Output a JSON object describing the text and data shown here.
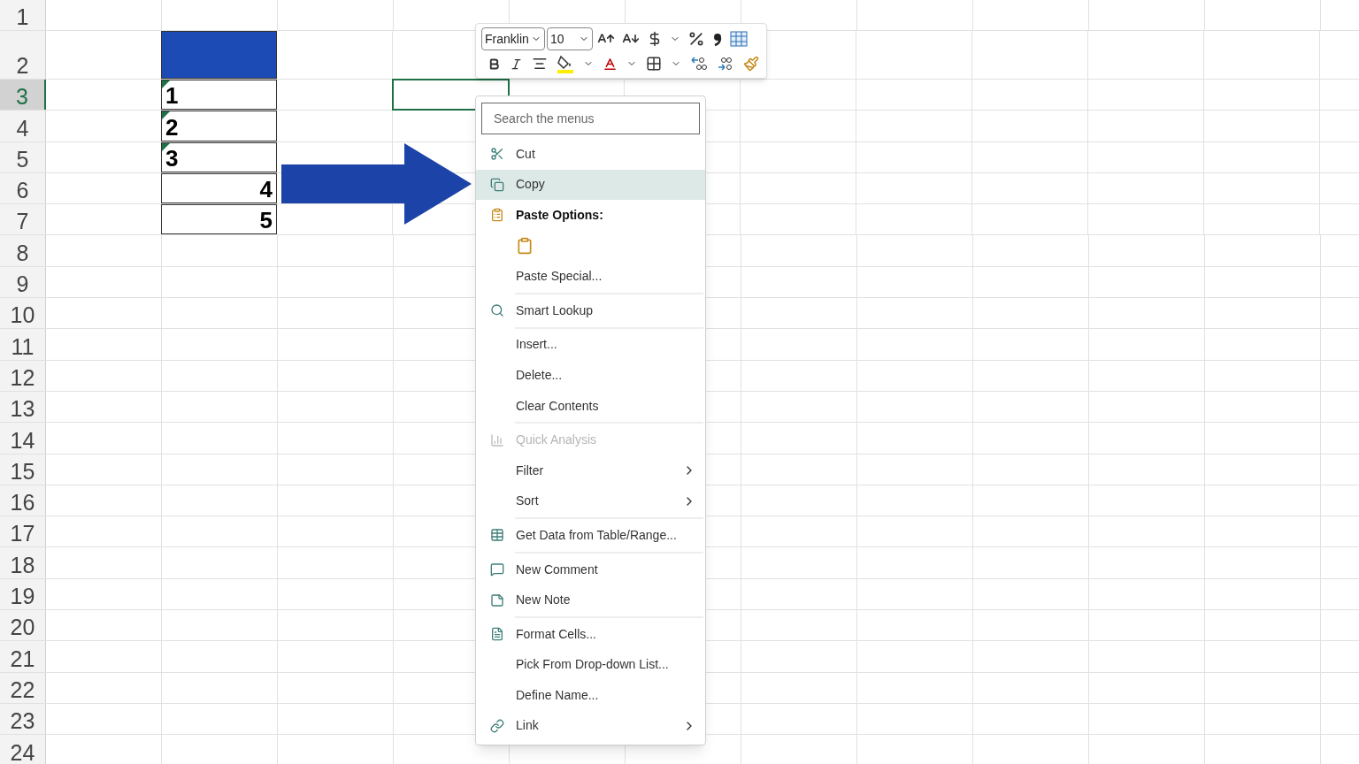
{
  "sheet": {
    "rows": [
      {
        "header": "1",
        "selected": false
      },
      {
        "header": "2",
        "selected": false,
        "column_2": {
          "kind": "filled"
        }
      },
      {
        "header": "3",
        "selected": true,
        "column_2": {
          "kind": "number",
          "value": "1",
          "error_flag": true
        },
        "column_4": {
          "kind": "plain",
          "selected": true
        }
      },
      {
        "header": "4",
        "selected": false,
        "column_2": {
          "kind": "number",
          "value": "2",
          "error_flag": true
        }
      },
      {
        "header": "5",
        "selected": false,
        "column_2": {
          "kind": "number",
          "value": "3",
          "error_flag": true
        }
      },
      {
        "header": "6",
        "selected": false,
        "column_2": {
          "kind": "number",
          "value": "4",
          "error_flag": false
        }
      },
      {
        "header": "7",
        "selected": false,
        "column_2": {
          "kind": "number",
          "value": "5",
          "error_flag": false
        }
      },
      {
        "header": "8",
        "selected": false
      },
      {
        "header": "9",
        "selected": false
      },
      {
        "header": "10",
        "selected": false
      },
      {
        "header": "11",
        "selected": false
      },
      {
        "header": "12",
        "selected": false
      },
      {
        "header": "13",
        "selected": false
      },
      {
        "header": "14",
        "selected": false
      },
      {
        "header": "15",
        "selected": false
      },
      {
        "header": "16",
        "selected": false
      },
      {
        "header": "17",
        "selected": false
      },
      {
        "header": "18",
        "selected": false
      },
      {
        "header": "19",
        "selected": false
      },
      {
        "header": "20",
        "selected": false
      },
      {
        "header": "21",
        "selected": false
      },
      {
        "header": "22",
        "selected": false
      },
      {
        "header": "23",
        "selected": false
      },
      {
        "header": "24",
        "selected": false
      }
    ]
  },
  "mini_toolbar": {
    "font": "Franklin",
    "size": "10"
  },
  "context_menu": {
    "search": {
      "placeholder": "Search the menus"
    },
    "items": [
      {
        "kind": "item",
        "label": "Cut",
        "selected": false,
        "disabled": false,
        "submenu": false,
        "separator_after": false
      },
      {
        "kind": "item",
        "label": "Copy",
        "selected": true,
        "disabled": false,
        "submenu": false,
        "separator_after": false
      },
      {
        "kind": "header",
        "label": "Paste Options:",
        "submenu": false,
        "separator_after": false
      },
      {
        "kind": "paste_buttons",
        "separator_after": false
      },
      {
        "kind": "item",
        "label": "Paste Special...",
        "selected": false,
        "disabled": false,
        "submenu": false,
        "separator_after": true
      },
      {
        "kind": "item",
        "label": "Smart Lookup",
        "selected": false,
        "disabled": false,
        "submenu": false,
        "separator_after": true
      },
      {
        "kind": "item",
        "label": "Insert...",
        "selected": false,
        "disabled": false,
        "submenu": false,
        "separator_after": false
      },
      {
        "kind": "item",
        "label": "Delete...",
        "selected": false,
        "disabled": false,
        "submenu": false,
        "separator_after": false
      },
      {
        "kind": "item",
        "label": "Clear Contents",
        "selected": false,
        "disabled": false,
        "submenu": false,
        "separator_after": true
      },
      {
        "kind": "item",
        "label": "Quick Analysis",
        "selected": false,
        "disabled": true,
        "submenu": false,
        "separator_after": false
      },
      {
        "kind": "item",
        "label": "Filter",
        "selected": false,
        "disabled": false,
        "submenu": true,
        "separator_after": false
      },
      {
        "kind": "item",
        "label": "Sort",
        "selected": false,
        "disabled": false,
        "submenu": true,
        "separator_after": true
      },
      {
        "kind": "item",
        "label": "Get Data from Table/Range...",
        "selected": false,
        "disabled": false,
        "submenu": false,
        "separator_after": true
      },
      {
        "kind": "item",
        "label": "New Comment",
        "selected": false,
        "disabled": false,
        "submenu": false,
        "separator_after": false
      },
      {
        "kind": "item",
        "label": "New Note",
        "selected": false,
        "disabled": false,
        "submenu": false,
        "separator_after": true
      },
      {
        "kind": "item",
        "label": "Format Cells...",
        "selected": false,
        "disabled": false,
        "submenu": false,
        "separator_after": false
      },
      {
        "kind": "item",
        "label": "Pick From Drop-down List...",
        "selected": false,
        "disabled": false,
        "submenu": false,
        "separator_after": false
      },
      {
        "kind": "item",
        "label": "Define Name...",
        "selected": false,
        "disabled": false,
        "submenu": false,
        "separator_after": false
      },
      {
        "kind": "item",
        "label": "Link",
        "selected": false,
        "disabled": false,
        "submenu": true,
        "separator_after": false
      }
    ]
  }
}
